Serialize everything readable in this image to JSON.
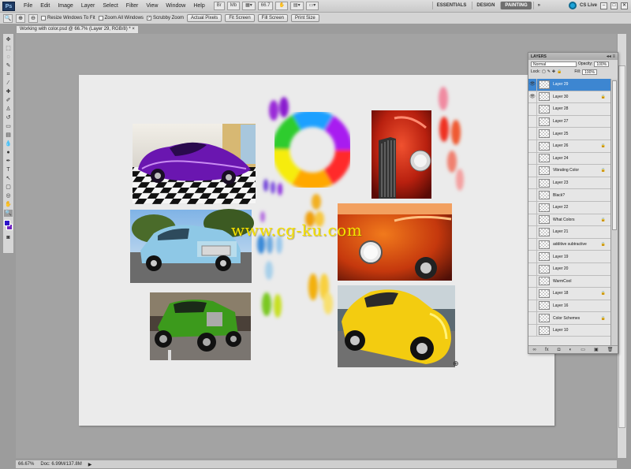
{
  "app": {
    "logo": "Ps",
    "menu": [
      "File",
      "Edit",
      "Image",
      "Layer",
      "Select",
      "Filter",
      "View",
      "Window",
      "Help"
    ],
    "zoom_readout": "66.7",
    "workspaces": [
      "ESSENTIALS",
      "DESIGN",
      "PAINTING"
    ],
    "workspace_more": "»",
    "active_workspace": "PAINTING",
    "cs_live": "CS Live"
  },
  "options": {
    "checkboxes": [
      "Resize Windows To Fit",
      "Zoom All Windows",
      "Scrubby Zoom"
    ],
    "buttons": [
      "Actual Pixels",
      "Fit Screen",
      "Fill Screen",
      "Print Size"
    ]
  },
  "document": {
    "tab_title": "Working with color.psd @ 66.7% (Layer 29, RGB/8) *",
    "zoom": "66.67%",
    "doc_size": "Doc: 6.99M/137.8M"
  },
  "watermark": "www.cg-ku.com",
  "layers_panel": {
    "title": "LAYERS",
    "blend_mode": "Normal",
    "opacity_label": "Opacity:",
    "opacity": "100%",
    "lock_label": "Lock:",
    "fill_label": "Fill:",
    "fill": "100%",
    "layers": [
      {
        "name": "Layer 29",
        "active": true,
        "visible": true,
        "locked": false
      },
      {
        "name": "Layer 30",
        "active": false,
        "visible": true,
        "locked": true
      },
      {
        "name": "Layer 28",
        "active": false,
        "visible": false,
        "locked": false
      },
      {
        "name": "Layer 27",
        "active": false,
        "visible": false,
        "locked": false
      },
      {
        "name": "Layer 25",
        "active": false,
        "visible": false,
        "locked": false
      },
      {
        "name": "Layer 26",
        "active": false,
        "visible": false,
        "locked": true
      },
      {
        "name": "Layer 24",
        "active": false,
        "visible": false,
        "locked": false
      },
      {
        "name": "Vibrating Color",
        "active": false,
        "visible": false,
        "locked": true
      },
      {
        "name": "Layer 23",
        "active": false,
        "visible": false,
        "locked": false
      },
      {
        "name": "Black?",
        "active": false,
        "visible": false,
        "locked": false
      },
      {
        "name": "Layer 22",
        "active": false,
        "visible": false,
        "locked": false
      },
      {
        "name": "What Colors",
        "active": false,
        "visible": false,
        "locked": true
      },
      {
        "name": "Layer 21",
        "active": false,
        "visible": false,
        "locked": false
      },
      {
        "name": "additive subtractive",
        "active": false,
        "visible": false,
        "locked": true
      },
      {
        "name": "Layer 19",
        "active": false,
        "visible": false,
        "locked": false
      },
      {
        "name": "Layer 20",
        "active": false,
        "visible": false,
        "locked": false
      },
      {
        "name": "WarmCool",
        "active": false,
        "visible": false,
        "locked": false
      },
      {
        "name": "Layer 18",
        "active": false,
        "visible": false,
        "locked": true
      },
      {
        "name": "Layer 16",
        "active": false,
        "visible": false,
        "locked": false
      },
      {
        "name": "Color Schemes",
        "active": false,
        "visible": false,
        "locked": true
      },
      {
        "name": "Layer 10",
        "active": false,
        "visible": false,
        "locked": false
      }
    ]
  },
  "colors": {
    "foreground": "#2d14c9",
    "background": "#6e1fbf",
    "selection": "#3d86d1"
  }
}
